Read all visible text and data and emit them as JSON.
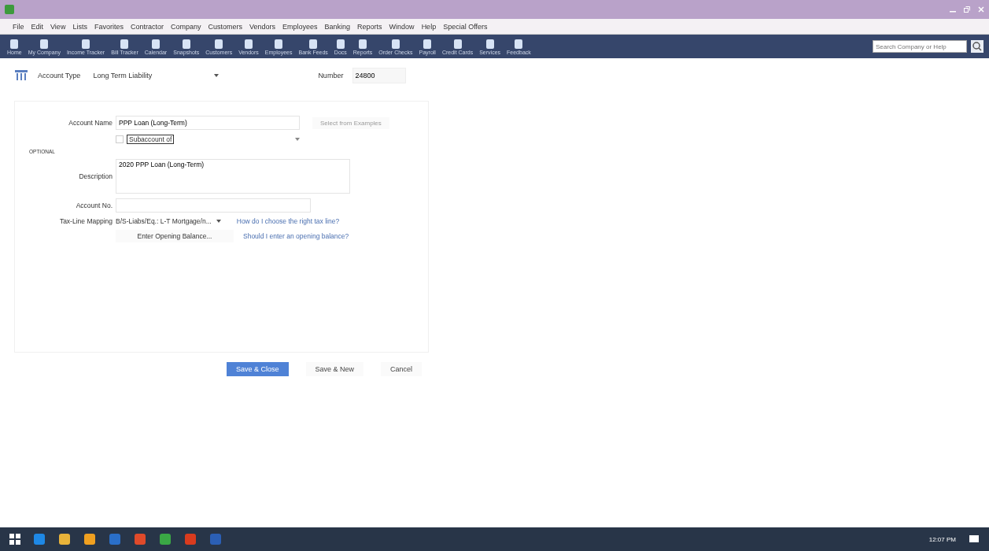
{
  "menu": [
    "File",
    "Edit",
    "View",
    "Lists",
    "Favorites",
    "Contractor",
    "Company",
    "Customers",
    "Vendors",
    "Employees",
    "Banking",
    "Reports",
    "Window",
    "Help",
    "Special Offers"
  ],
  "toolbar": [
    "Home",
    "My Company",
    "Income Tracker",
    "Bill Tracker",
    "Calendar",
    "Snapshots",
    "Customers",
    "Vendors",
    "Employees",
    "Bank Feeds",
    "Docs",
    "Reports",
    "Order Checks",
    "Payroll",
    "Credit Cards",
    "Services",
    "Feedback"
  ],
  "search": {
    "placeholder": "Search Company or Help"
  },
  "account_type": {
    "label": "Account Type",
    "value": "Long Term Liability"
  },
  "number": {
    "label": "Number",
    "value": "24800"
  },
  "account_name": {
    "label": "Account Name",
    "value": "PPP Loan (Long-Term)"
  },
  "examples_button": {
    "label": "Select from Examples",
    "disabled": true
  },
  "subaccount": {
    "label": "Subaccount of",
    "checked": false
  },
  "optional_label": "OPTIONAL",
  "description": {
    "label": "Description",
    "value": "2020 PPP Loan (Long-Term)"
  },
  "account_no": {
    "label": "Account No."
  },
  "tax_line": {
    "label": "Tax-Line Mapping",
    "value": "B/S-Liabs/Eq.: L-T Mortgage/n...",
    "help": "How do I choose the right tax line?"
  },
  "opening_balance": {
    "label": "Enter Opening Balance...",
    "help": "Should I enter an opening balance?"
  },
  "buttons": [
    {
      "label": "Save & Close",
      "primary": true
    },
    {
      "label": "Save & New",
      "primary": false
    },
    {
      "label": "Cancel",
      "primary": false
    }
  ],
  "taskbar": {
    "time": "12:07 PM"
  }
}
